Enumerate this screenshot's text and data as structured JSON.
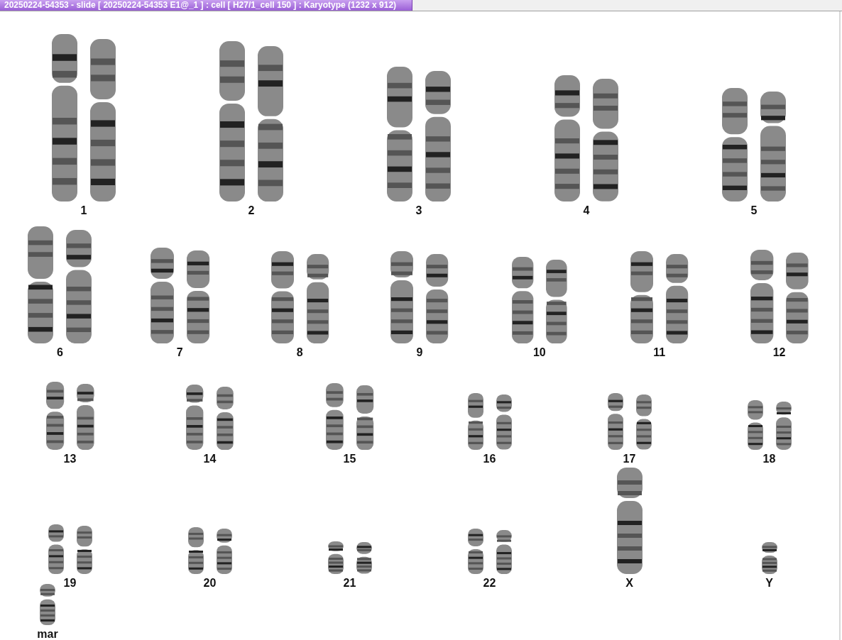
{
  "window": {
    "title": "20250224-54353 - slide [ 20250224-54353 E1@_1 ] : cell [ H27/1_cell 150 ] : Karyotype  (1232 x 912)"
  },
  "karyotype": {
    "rows": [
      {
        "groups": [
          {
            "label": "1",
            "kind": "pair"
          },
          {
            "label": "2",
            "kind": "pair"
          },
          {
            "label": "3",
            "kind": "pair"
          },
          {
            "label": "4",
            "kind": "pair"
          },
          {
            "label": "5",
            "kind": "pair"
          }
        ]
      },
      {
        "groups": [
          {
            "label": "6",
            "kind": "pair"
          },
          {
            "label": "7",
            "kind": "pair"
          },
          {
            "label": "8",
            "kind": "pair"
          },
          {
            "label": "9",
            "kind": "pair"
          },
          {
            "label": "10",
            "kind": "pair"
          },
          {
            "label": "11",
            "kind": "pair"
          },
          {
            "label": "12",
            "kind": "pair"
          }
        ]
      },
      {
        "groups": [
          {
            "label": "13",
            "kind": "pair"
          },
          {
            "label": "14",
            "kind": "pair"
          },
          {
            "label": "15",
            "kind": "pair"
          },
          {
            "label": "16",
            "kind": "pair"
          },
          {
            "label": "17",
            "kind": "pair"
          },
          {
            "label": "18",
            "kind": "pair"
          }
        ]
      },
      {
        "groups": [
          {
            "label": "19",
            "kind": "pair"
          },
          {
            "label": "20",
            "kind": "pair"
          },
          {
            "label": "21",
            "kind": "pair"
          },
          {
            "label": "22",
            "kind": "pair"
          },
          {
            "label": "X",
            "kind": "single"
          },
          {
            "label": "Y",
            "kind": "single"
          }
        ]
      },
      {
        "groups": [
          {
            "label": "mar",
            "kind": "single"
          }
        ]
      }
    ]
  }
}
